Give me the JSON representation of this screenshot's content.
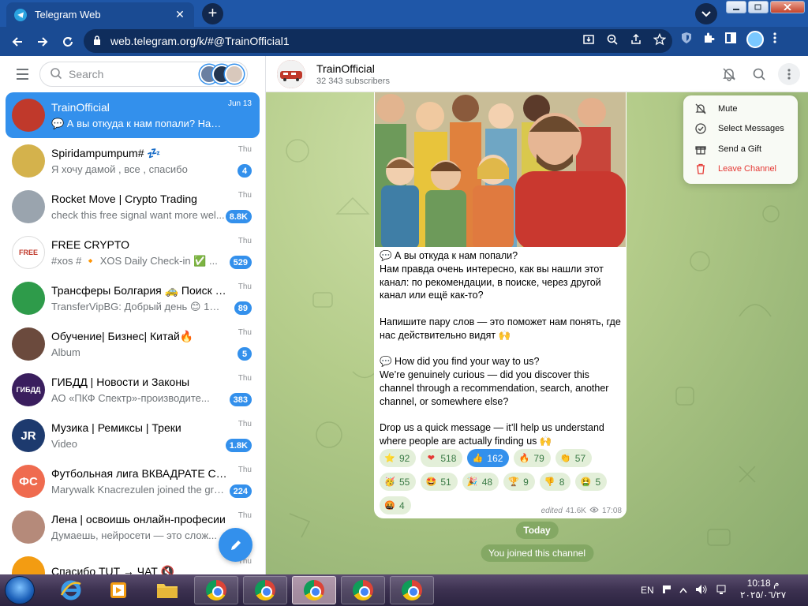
{
  "browser": {
    "tab_title": "Telegram Web",
    "url": "web.telegram.org/k/#@TrainOfficial1",
    "tab_close_glyph": "✕",
    "new_tab_glyph": "+"
  },
  "sidebar": {
    "search_placeholder": "Search",
    "chats": [
      {
        "title": "TrainOfficial",
        "preview": "💬 А вы откуда к нам попали? Нам п...",
        "time": "Jun 13",
        "badge": "",
        "active": true,
        "avatar_color": "#c0392b",
        "avatar_text": ""
      },
      {
        "title": "Spiridampumpum# 💤",
        "preview": "Я хочу дамой , все , спасибо",
        "time": "Thu",
        "badge": "4",
        "active": false,
        "avatar_color": "#d4b24c",
        "avatar_text": ""
      },
      {
        "title": "Rocket Move | Crypto Trading",
        "preview": "check this free signal want more wel...",
        "time": "Thu",
        "badge": "8.8K",
        "active": false,
        "avatar_color": "#9aa4ae",
        "avatar_text": ""
      },
      {
        "title": "FREE CRYPTO",
        "preview": "#xos # 🔸 XOS Daily Check-in ✅ ...",
        "time": "Thu",
        "badge": "529",
        "active": false,
        "avatar_color": "#ffffff",
        "avatar_text": "FREE"
      },
      {
        "title": "Трансферы Болгария 🚕 Поиск попу...",
        "preview": "TransferVipBG: Добрый день 😊 12 и...",
        "time": "Thu",
        "badge": "89",
        "active": false,
        "avatar_color": "#2e9b4a",
        "avatar_text": ""
      },
      {
        "title": "Обучение| Бизнес| Китай🔥",
        "preview": "Album",
        "time": "Thu",
        "badge": "5",
        "active": false,
        "avatar_color": "#6b4a3d",
        "avatar_text": ""
      },
      {
        "title": "ГИБДД | Новости и Законы",
        "preview": "АО «ПКФ Спектр»-производите...",
        "time": "Thu",
        "badge": "383",
        "active": false,
        "avatar_color": "#3a1e5e",
        "avatar_text": "ГИБДД"
      },
      {
        "title": "Музика | Ремиксы | Треки",
        "preview": "Video",
        "time": "Thu",
        "badge": "1.8K",
        "active": false,
        "avatar_color": "#1d3a6e",
        "avatar_text": "JR"
      },
      {
        "title": "Футбольная лига ВКВАДРАТЕ Chat",
        "preview": "Marywalk Knacrezulen joined the gro...",
        "time": "Thu",
        "badge": "224",
        "active": false,
        "avatar_color": "#ef6b4f",
        "avatar_text": "ФС"
      },
      {
        "title": "Лена | освоишь онлайн-професии",
        "preview": "Думаешь, нейросети — это слож...",
        "time": "Thu",
        "badge": "",
        "active": false,
        "avatar_color": "#b58a7a",
        "avatar_text": ""
      },
      {
        "title": "Спасибо TUT → ЧАТ 🔇",
        "preview": "",
        "time": "Thu",
        "badge": "",
        "active": false,
        "avatar_color": "#f39c12",
        "avatar_text": ""
      }
    ]
  },
  "chat": {
    "title": "TrainOfficial",
    "subtitle": "32 343 subscribers",
    "message_text": "💬 А вы откуда к нам попали?\nНам правда очень интересно, как вы нашли этот канал: по рекомендации, в поиске, через другой канал или ещё как-то?\n\nНапишите пару слов — это поможет нам понять, где нас действительно видят 🙌\n\n💬 How did you find your way to us?\nWe’re genuinely curious — did you discover this channel through a recommendation, search, another channel, or somewhere else?\n\nDrop us a quick message — it’ll help us understand where people are actually finding us 🙌",
    "reactions": [
      {
        "emoji": "⭐",
        "count": "92",
        "mine": false,
        "color": "#f6c343"
      },
      {
        "emoji": "❤",
        "count": "518",
        "mine": false,
        "color": "#e53935"
      },
      {
        "emoji": "👍",
        "count": "162",
        "mine": true,
        "color": "#f6c343"
      },
      {
        "emoji": "🔥",
        "count": "79",
        "mine": false,
        "color": "#ff7a1a"
      },
      {
        "emoji": "👏",
        "count": "57",
        "mine": false,
        "color": "#f6c343"
      },
      {
        "emoji": "🥳",
        "count": "55",
        "mine": false,
        "color": "#f6c343"
      },
      {
        "emoji": "🤩",
        "count": "51",
        "mine": false,
        "color": "#f6c343"
      },
      {
        "emoji": "🎉",
        "count": "48",
        "mine": false,
        "color": "#a86ad9"
      },
      {
        "emoji": "🏆",
        "count": "9",
        "mine": false,
        "color": "#e0a21a"
      },
      {
        "emoji": "👎",
        "count": "8",
        "mine": false,
        "color": "#f6c343"
      },
      {
        "emoji": "🤮",
        "count": "5",
        "mine": false,
        "color": "#7cc242"
      },
      {
        "emoji": "🤬",
        "count": "4",
        "mine": false,
        "color": "#d63b2e"
      }
    ],
    "edited_label": "edited",
    "views": "41.6K",
    "time": "17:08",
    "date_pill": "Today",
    "service_message": "You joined this channel"
  },
  "context_menu": {
    "items": [
      {
        "label": "Mute",
        "icon": "mute-icon",
        "danger": false
      },
      {
        "label": "Select Messages",
        "icon": "check-circle-icon",
        "danger": false
      },
      {
        "label": "Send a Gift",
        "icon": "gift-icon",
        "danger": false
      },
      {
        "label": "Leave Channel",
        "icon": "trash-icon",
        "danger": true
      }
    ]
  },
  "taskbar": {
    "lang": "EN",
    "time": "10:18 م",
    "date": "٢٠٢٥/٠٦/٢٧"
  },
  "colors": {
    "accent": "#3390ec",
    "browser_chrome": "#1a4b93",
    "danger": "#e53935"
  }
}
